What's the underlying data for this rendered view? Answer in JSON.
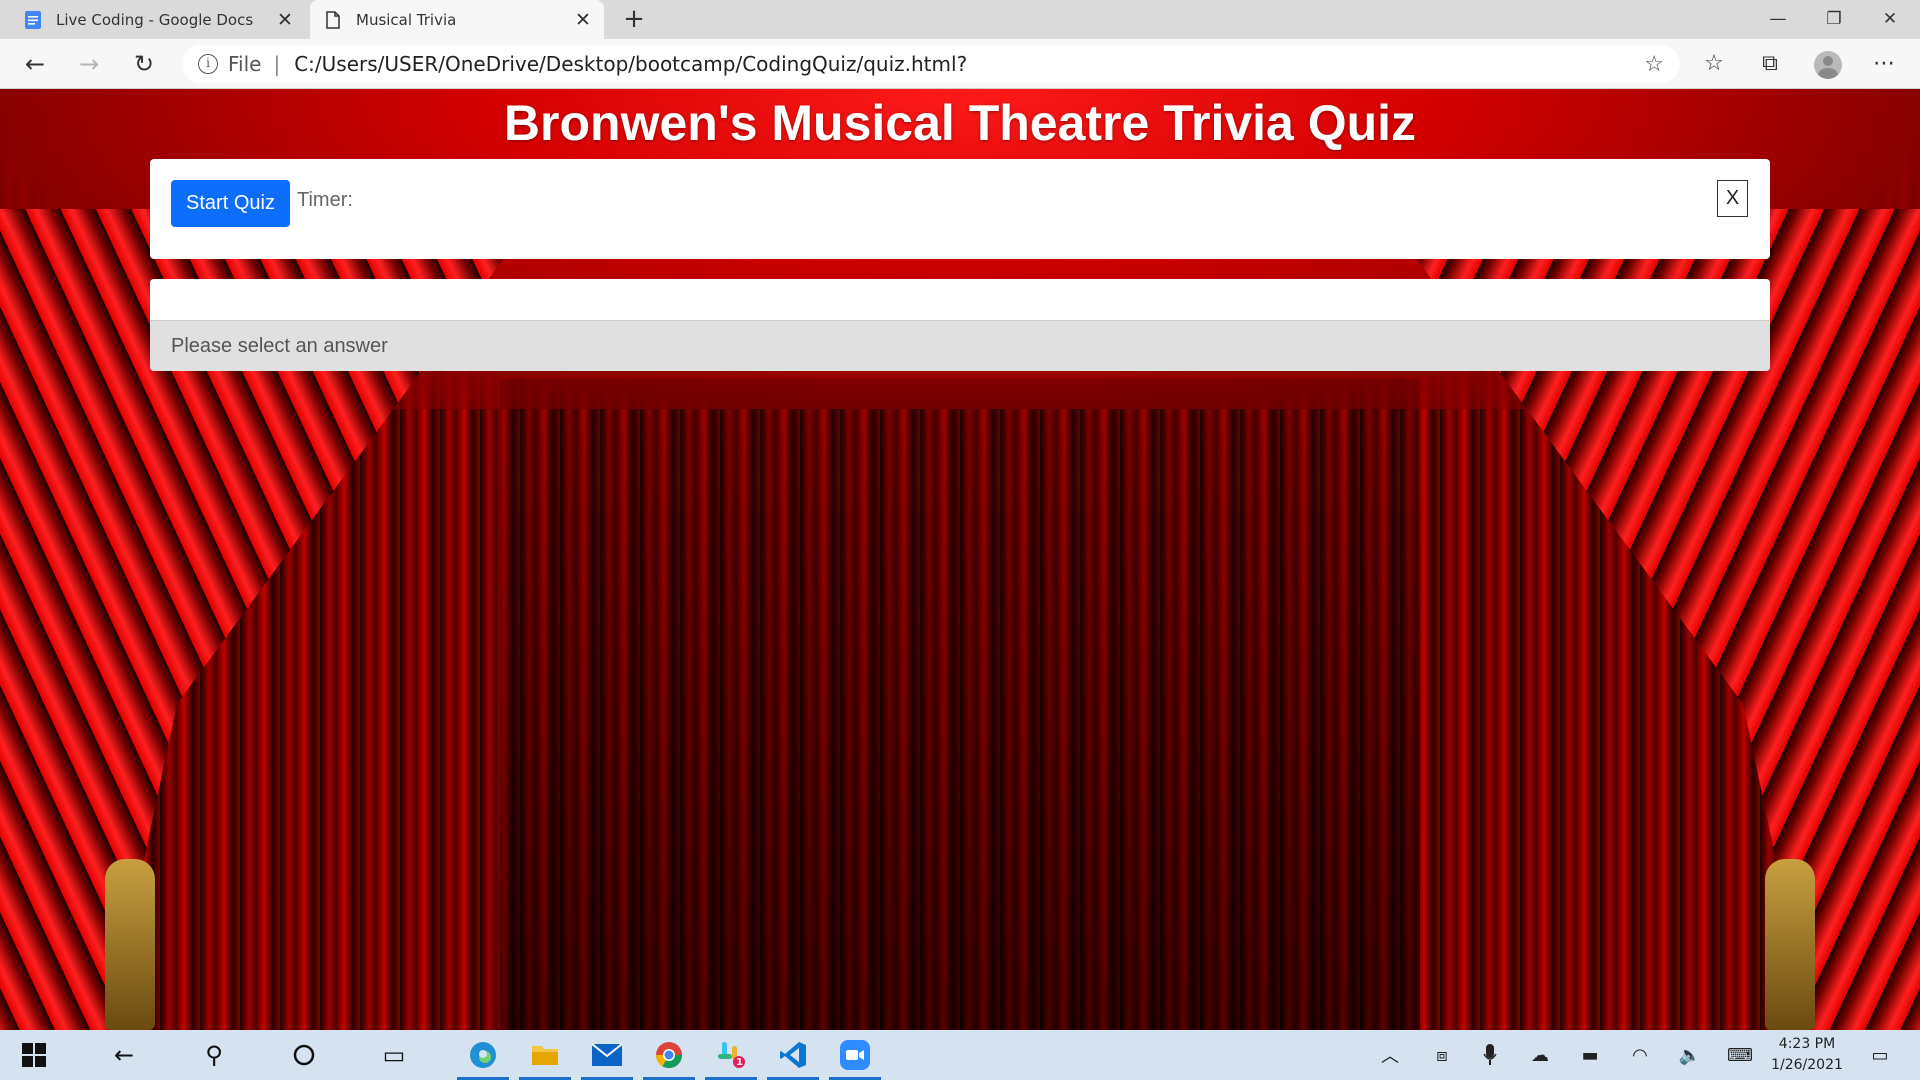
{
  "browser": {
    "tabs": [
      {
        "title": "Live Coding - Google Docs",
        "icon": "google-docs-icon",
        "active": false
      },
      {
        "title": "Musical Trivia",
        "icon": "page-icon",
        "active": true
      }
    ],
    "address": {
      "scheme": "File",
      "url": "C:/Users/USER/OneDrive/Desktop/bootcamp/CodingQuiz/quiz.html?"
    }
  },
  "page": {
    "title": "Bronwen's Musical Theatre Trivia Quiz",
    "start_button": "Start Quiz",
    "timer_label": "Timer:",
    "close_button": "X",
    "question_text": "",
    "answer_prompt": "Please select an answer"
  },
  "taskbar": {
    "time": "4:23 PM",
    "date": "1/26/2021",
    "slack_badge": "1",
    "pinned": [
      "edge-icon",
      "file-explorer-icon",
      "mail-icon",
      "chrome-icon",
      "slack-icon",
      "vscode-icon",
      "zoom-icon"
    ]
  },
  "colors": {
    "accent_button": "#0d6efd",
    "curtain_red": "#d40000",
    "taskbar": "#d5e3f1"
  }
}
